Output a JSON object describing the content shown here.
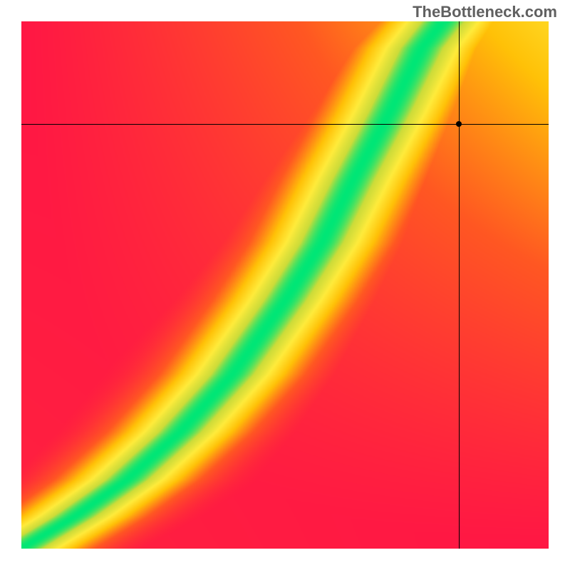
{
  "watermark": "TheBottleneck.com",
  "chart_data": {
    "type": "heatmap",
    "title": "",
    "xlabel": "",
    "ylabel": "",
    "xlim": [
      0,
      1
    ],
    "ylim": [
      0,
      1
    ],
    "legend": false,
    "colorscale": {
      "stops": [
        {
          "t": 0.0,
          "color": "#ff1744"
        },
        {
          "t": 0.3,
          "color": "#ff5722"
        },
        {
          "t": 0.55,
          "color": "#ffc107"
        },
        {
          "t": 0.75,
          "color": "#ffeb3b"
        },
        {
          "t": 0.9,
          "color": "#cddc39"
        },
        {
          "t": 1.0,
          "color": "#00e676"
        }
      ]
    },
    "ridge": {
      "description": "Optimal match curve (green band) from bottom-left to top-right; curve bows right (GPU-heavy).",
      "points_xy": [
        [
          0.0,
          0.0
        ],
        [
          0.1,
          0.06
        ],
        [
          0.2,
          0.13
        ],
        [
          0.3,
          0.22
        ],
        [
          0.4,
          0.33
        ],
        [
          0.5,
          0.47
        ],
        [
          0.57,
          0.58
        ],
        [
          0.63,
          0.7
        ],
        [
          0.7,
          0.83
        ],
        [
          0.76,
          0.95
        ],
        [
          0.8,
          1.0
        ]
      ],
      "band_halfwidth_x": 0.05
    },
    "field_bias": {
      "top_right": 0.72,
      "bottom_left": 0.05,
      "top_left": 0.0,
      "bottom_right": 0.0
    },
    "marker": {
      "x": 0.83,
      "y": 0.805,
      "label": ""
    },
    "crosshair": {
      "x": 0.83,
      "y": 0.805
    }
  }
}
